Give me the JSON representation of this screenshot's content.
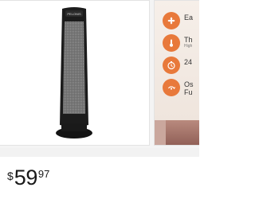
{
  "product": {
    "brand": "PELONIS",
    "image_alt_icon": "tower-heater-icon"
  },
  "features": [
    {
      "icon": "fan-icon",
      "title": "Ea",
      "subtitle": ""
    },
    {
      "icon": "thermometer-icon",
      "title": "Th",
      "subtitle": "High"
    },
    {
      "icon": "timer-icon",
      "title": "24",
      "subtitle": ""
    },
    {
      "icon": "oscillation-icon",
      "title": "Os",
      "subtitle": "",
      "title2": "Fu"
    }
  ],
  "price": {
    "currency": "$",
    "dollars": "59",
    "cents": "97"
  },
  "colors": {
    "accent": "#e8793b",
    "text": "#1a1a1a"
  }
}
